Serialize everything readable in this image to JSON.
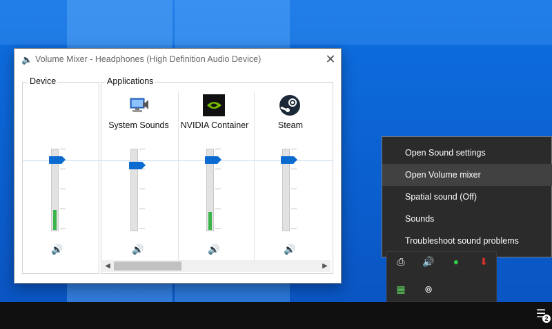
{
  "window": {
    "title": "Volume Mixer - Headphones (High Definition Audio Device)",
    "close_glyph": "✕"
  },
  "device_group": {
    "label": "Device"
  },
  "apps_group": {
    "label": "Applications"
  },
  "apps": [
    {
      "label": "System Sounds",
      "icon": "system-sounds-icon"
    },
    {
      "label": "NVIDIA Container",
      "icon": "nvidia-icon"
    },
    {
      "label": "Steam",
      "icon": "steam-icon"
    }
  ],
  "sliders": {
    "device_level_fraction": 0.25,
    "nvidia_level_fraction": 0.22
  },
  "context_menu": {
    "items": [
      {
        "label": "Open Sound settings"
      },
      {
        "label": "Open Volume mixer"
      },
      {
        "label": "Spatial sound (Off)"
      },
      {
        "label": "Sounds"
      },
      {
        "label": "Troubleshoot sound problems"
      }
    ],
    "highlighted_index": 1
  },
  "taskbar": {
    "notification_count": "2"
  },
  "colors": {
    "accent": "#0b6bd1",
    "level_green": "#3ab54a",
    "menu_bg": "#2b2b2b"
  }
}
